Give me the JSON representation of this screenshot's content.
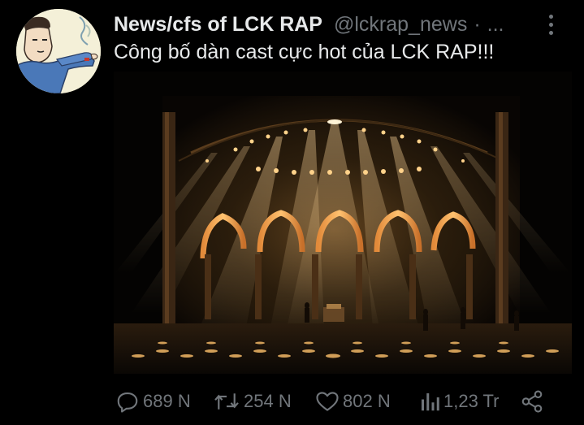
{
  "tweet": {
    "display_name": "News/cfs of LCK RAP",
    "handle": "@lckrap_news",
    "separator": "·",
    "date_truncated": "...",
    "text": "Công bố dàn cast cực hot của LCK RAP!!!"
  },
  "actions": {
    "reply_count": "689 N",
    "retweet_count": "254 N",
    "like_count": "802 N",
    "views_count": "1,23 Tr"
  },
  "icons": {
    "reply": "reply-icon",
    "retweet": "retweet-icon",
    "like": "like-icon",
    "views": "views-icon",
    "share": "share-icon",
    "more": "more-vertical-icon"
  },
  "colors": {
    "background": "#000000",
    "primary_text": "#e7e9ea",
    "secondary_text": "#71767b",
    "stage_light": "#f0b46a"
  }
}
